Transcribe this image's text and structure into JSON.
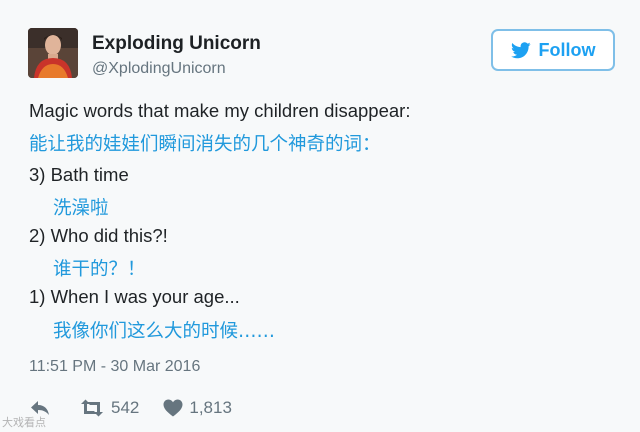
{
  "tweet": {
    "author_name": "Exploding Unicorn",
    "author_handle": "@XplodingUnicorn",
    "follow_label": "Follow",
    "lines": [
      {
        "text": "Magic words that make my children disappear:",
        "lang": "en"
      },
      {
        "text": "能让我的娃娃们瞬间消失的几个神奇的词：",
        "lang": "zh"
      },
      {
        "text": "3) Bath time",
        "lang": "en"
      },
      {
        "text": "洗澡啦",
        "lang": "zh"
      },
      {
        "text": "2) Who did this?!",
        "lang": "en"
      },
      {
        "text": "谁干的？！",
        "lang": "zh"
      },
      {
        "text": "1) When I was your age...",
        "lang": "en"
      },
      {
        "text": "我像你们这么大的时候……",
        "lang": "zh"
      }
    ],
    "timestamp": "11:51 PM - 30 Mar 2016",
    "retweets": "542",
    "likes": "1,813"
  },
  "icons": {
    "follow": "twitter-bird-icon",
    "reply": "reply-icon",
    "retweet": "retweet-icon",
    "like": "heart-icon"
  },
  "watermark": "大戏看点",
  "colors": {
    "accent": "#1da1f2",
    "chinese_text": "#2199dc",
    "muted": "#66757f"
  }
}
